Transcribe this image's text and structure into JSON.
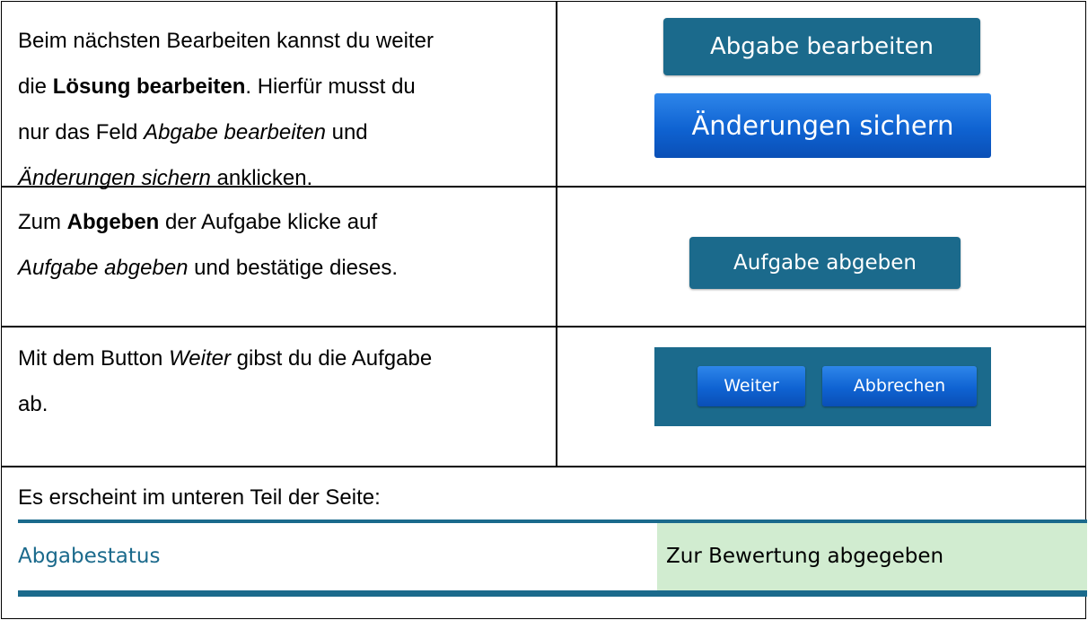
{
  "rows": [
    {
      "lines": [
        {
          "pre": "Beim nächsten Bearbeiten kannst du weiter"
        },
        {
          "pre": "die ",
          "bold": "Lösung bearbeiten",
          "post": ".  Hierfür musst du"
        },
        {
          "pre": "nur das Feld ",
          "italic": "Abgabe bearbeiten",
          "post": " und"
        },
        {
          "italic": "Änderungen sichern",
          "post": " anklicken."
        }
      ],
      "buttons": [
        "Abgabe bearbeiten",
        "Änderungen sichern"
      ]
    },
    {
      "lines": [
        {
          "pre": "Zum ",
          "bold": "Abgeben",
          "post": " der Aufgabe klicke auf"
        },
        {
          "italic": "Aufgabe abgeben",
          "post": " und bestätige dieses."
        }
      ],
      "buttons": [
        "Aufgabe abgeben"
      ]
    },
    {
      "lines": [
        {
          "pre": "Mit dem Button ",
          "italic": "Weiter",
          "post": " gibst du die Aufgabe"
        },
        {
          "pre": "ab."
        }
      ],
      "buttons": [
        "Weiter",
        "Abbrechen"
      ]
    }
  ],
  "footer": {
    "text": "Es erscheint im unteren Teil der Seite:",
    "status_label": "Abgabestatus",
    "status_value": "Zur Bewertung abgegeben"
  },
  "colors": {
    "teal": "#1b6a8c",
    "blue": "#0f63d2",
    "status_green": "#d1ecd0"
  }
}
